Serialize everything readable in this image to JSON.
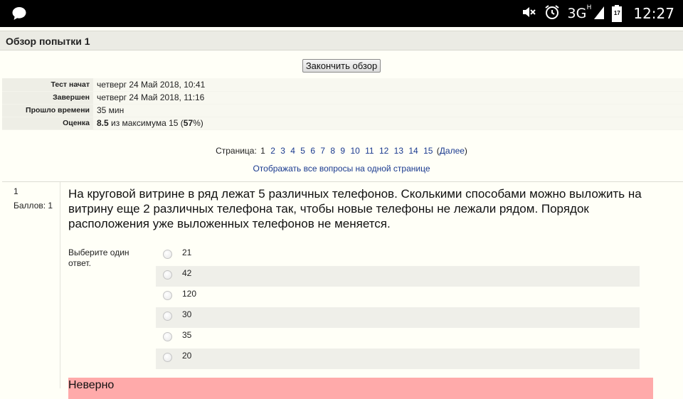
{
  "status_bar": {
    "time": "12:27",
    "network": "3G",
    "network_sup": "H",
    "battery_level": "17",
    "icons": [
      "chat-bubble-icon",
      "mute-icon",
      "alarm-icon",
      "signal-icon",
      "battery-icon"
    ]
  },
  "header": {
    "title": "Обзор попытки 1"
  },
  "finish_button": "Закончить обзор",
  "summary": [
    {
      "label": "Тест начат",
      "value": "четверг 24 Май 2018, 10:41"
    },
    {
      "label": "Завершен",
      "value": "четверг 24 Май 2018, 11:16"
    },
    {
      "label": "Прошло времени",
      "value": "35 мин"
    }
  ],
  "grade": {
    "label": "Оценка",
    "score": "8.5",
    "text_mid": " из максимума 15 (",
    "percent": "57",
    "text_end": "%)"
  },
  "pager": {
    "label": "Страница:",
    "current": "1",
    "pages": [
      "2",
      "3",
      "4",
      "5",
      "6",
      "7",
      "8",
      "9",
      "10",
      "11",
      "12",
      "13",
      "14",
      "15"
    ],
    "next_label": "Далее",
    "open_paren": "(",
    "close_paren": ")"
  },
  "show_all_link": "Отображать все вопросы на одной странице",
  "question": {
    "number": "1",
    "points": "Баллов: 1",
    "text": "На круговой витрине в ряд лежат 5 различных телефонов. Сколькими способами можно выложить на витрину еще 2 различных телефона так, чтобы новые телефоны не лежали рядом. Порядок расположения уже выложенных телефонов не меняется.",
    "prompt": "Выберите один ответ.",
    "answers": [
      "21",
      "42",
      "120",
      "30",
      "35",
      "20"
    ],
    "feedback": "Неверно"
  }
}
